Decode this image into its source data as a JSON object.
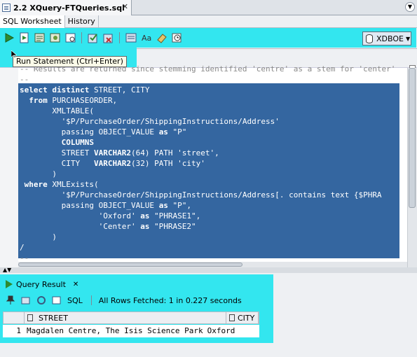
{
  "editor_tab": {
    "title": "2.2 XQuery-FTQueries.sql",
    "close": "✕"
  },
  "subtabs": [
    "SQL Worksheet",
    "History"
  ],
  "connection": {
    "name": "XDBOE"
  },
  "tooltip": "Run Statement (Ctrl+Enter)",
  "highlight_color": "#33e6ef",
  "code_lines": [
    {
      "text": "-- Results are returned since stemming identified 'centre' as a stem for 'center'",
      "style": "dim"
    },
    {
      "text": "--",
      "style": "dim"
    },
    {
      "parts": [
        [
          "kw",
          "select distinct"
        ],
        [
          "w",
          " STREET, CITY"
        ]
      ]
    },
    {
      "parts": [
        [
          "w",
          "  "
        ],
        [
          "kw",
          "from"
        ],
        [
          "w",
          " PURCHASEORDER,"
        ]
      ]
    },
    {
      "parts": [
        [
          "w",
          "       XMLTABLE("
        ]
      ]
    },
    {
      "parts": [
        [
          "w",
          "         '$P/PurchaseOrder/ShippingInstructions/Address'"
        ]
      ]
    },
    {
      "parts": [
        [
          "w",
          "         passing OBJECT_VALUE "
        ],
        [
          "kw",
          "as"
        ],
        [
          "w",
          " \"P\""
        ]
      ]
    },
    {
      "parts": [
        [
          "w",
          "         "
        ],
        [
          "kw",
          "COLUMNS"
        ]
      ]
    },
    {
      "parts": [
        [
          "w",
          "         STREET "
        ],
        [
          "kw",
          "VARCHAR2"
        ],
        [
          "w",
          "(64) PATH 'street',"
        ]
      ]
    },
    {
      "parts": [
        [
          "w",
          "         CITY   "
        ],
        [
          "kw",
          "VARCHAR2"
        ],
        [
          "w",
          "(32) PATH 'city'"
        ]
      ]
    },
    {
      "parts": [
        [
          "w",
          "       )"
        ]
      ]
    },
    {
      "parts": [
        [
          "w",
          " "
        ],
        [
          "kw",
          "where"
        ],
        [
          "w",
          " XMLExists("
        ]
      ]
    },
    {
      "parts": [
        [
          "w",
          "         '$P/PurchaseOrder/ShippingInstructions/Address[. contains text {$PHRA"
        ]
      ]
    },
    {
      "parts": [
        [
          "w",
          "         passing OBJECT_VALUE "
        ],
        [
          "kw",
          "as"
        ],
        [
          "w",
          " \"P\","
        ]
      ]
    },
    {
      "parts": [
        [
          "w",
          "                 'Oxford' "
        ],
        [
          "kw",
          "as"
        ],
        [
          "w",
          " \"PHRASE1\","
        ]
      ]
    },
    {
      "parts": [
        [
          "w",
          "                 'Center' "
        ],
        [
          "kw",
          "as"
        ],
        [
          "w",
          " \"PHRASE2\""
        ]
      ]
    },
    {
      "parts": [
        [
          "w",
          "       )"
        ]
      ]
    },
    {
      "parts": [
        [
          "w",
          "/"
        ]
      ]
    },
    {
      "text": "--",
      "style": "dim"
    }
  ],
  "results": {
    "tab_label": "Query Result",
    "sql_label": "SQL",
    "status": "All Rows Fetched: 1 in 0.227 seconds",
    "columns": [
      "STREET",
      "CITY"
    ],
    "rows": [
      {
        "num": "1",
        "street": "Magdalen Centre, The Isis Science Park",
        "city": "Oxford"
      }
    ]
  }
}
